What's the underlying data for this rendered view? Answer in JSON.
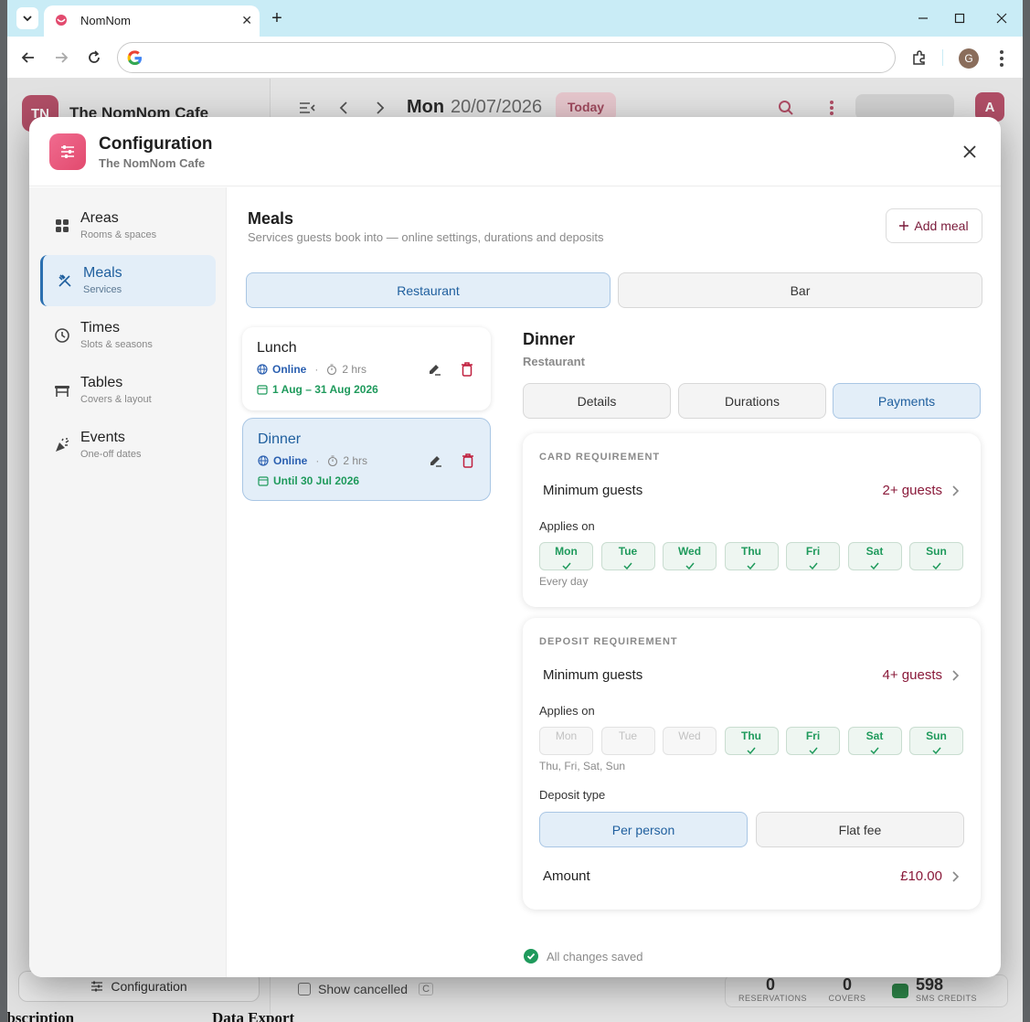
{
  "browser": {
    "tab_title": "NomNom",
    "omnibox_placeholder": "",
    "profile_initial": "G"
  },
  "background_app": {
    "logo_initials": "TN",
    "cafe_name": "The NomNom Cafe",
    "day": "Mon",
    "date": "20/07/2026",
    "today_label": "Today",
    "avatar_initial": "A",
    "config_button": "Configuration",
    "show_cancelled": "Show cancelled",
    "show_cancelled_key": "C",
    "reservations_count": "0",
    "reservations_label": "RESERVATIONS",
    "covers_count": "0",
    "covers_label": "COVERS",
    "sms_count": "598",
    "sms_label": "SMS CREDITS",
    "bottom_left_text": "ubscription",
    "bottom_right_text": "Data Export"
  },
  "modal": {
    "title": "Configuration",
    "subtitle": "The NomNom Cafe"
  },
  "sidebar": {
    "items": [
      {
        "label": "Areas",
        "sub": "Rooms & spaces",
        "icon": "grid-icon"
      },
      {
        "label": "Meals",
        "sub": "Services",
        "icon": "utensils-icon"
      },
      {
        "label": "Times",
        "sub": "Slots & seasons",
        "icon": "clock-icon"
      },
      {
        "label": "Tables",
        "sub": "Covers & layout",
        "icon": "table-icon"
      },
      {
        "label": "Events",
        "sub": "One-off dates",
        "icon": "party-popper-icon"
      }
    ],
    "active_index": 1
  },
  "meals_section": {
    "title": "Meals",
    "description": "Services guests book into — online settings, durations and deposits",
    "add_meal_label": "Add meal",
    "venues": [
      "Restaurant",
      "Bar"
    ],
    "active_venue": "Restaurant",
    "meals": [
      {
        "name": "Lunch",
        "online": "Online",
        "duration": "2 hrs",
        "dates": "1 Aug – 31 Aug 2026"
      },
      {
        "name": "Dinner",
        "online": "Online",
        "duration": "2 hrs",
        "dates": "Until 30 Jul 2026"
      }
    ],
    "selected_meal": "Dinner"
  },
  "detail": {
    "title": "Dinner",
    "subtitle": "Restaurant",
    "tabs": [
      "Details",
      "Durations",
      "Payments"
    ],
    "active_tab": "Payments",
    "card_requirement": {
      "heading": "CARD REQUIREMENT",
      "min_guests_label": "Minimum guests",
      "min_guests_value": "2+ guests",
      "applies_on_label": "Applies on",
      "days": [
        {
          "name": "Mon",
          "on": true
        },
        {
          "name": "Tue",
          "on": true
        },
        {
          "name": "Wed",
          "on": true
        },
        {
          "name": "Thu",
          "on": true
        },
        {
          "name": "Fri",
          "on": true
        },
        {
          "name": "Sat",
          "on": true
        },
        {
          "name": "Sun",
          "on": true
        }
      ],
      "days_summary": "Every day"
    },
    "deposit_requirement": {
      "heading": "DEPOSIT REQUIREMENT",
      "min_guests_label": "Minimum guests",
      "min_guests_value": "4+ guests",
      "applies_on_label": "Applies on",
      "days": [
        {
          "name": "Mon",
          "on": false
        },
        {
          "name": "Tue",
          "on": false
        },
        {
          "name": "Wed",
          "on": false
        },
        {
          "name": "Thu",
          "on": true
        },
        {
          "name": "Fri",
          "on": true
        },
        {
          "name": "Sat",
          "on": true
        },
        {
          "name": "Sun",
          "on": true
        }
      ],
      "days_summary": "Thu, Fri, Sat, Sun",
      "deposit_type_label": "Deposit type",
      "deposit_types": [
        "Per person",
        "Flat fee"
      ],
      "active_deposit_type": "Per person",
      "amount_label": "Amount",
      "amount_value": "£10.00"
    }
  },
  "status": {
    "saved_text": "All changes saved"
  },
  "colors": {
    "accent_blue": "#1f5f9e",
    "active_bg": "#e3eef8",
    "brand_pink": "#e24a6e",
    "value_maroon": "#8a1a3a",
    "success_green": "#1f9a5c"
  }
}
